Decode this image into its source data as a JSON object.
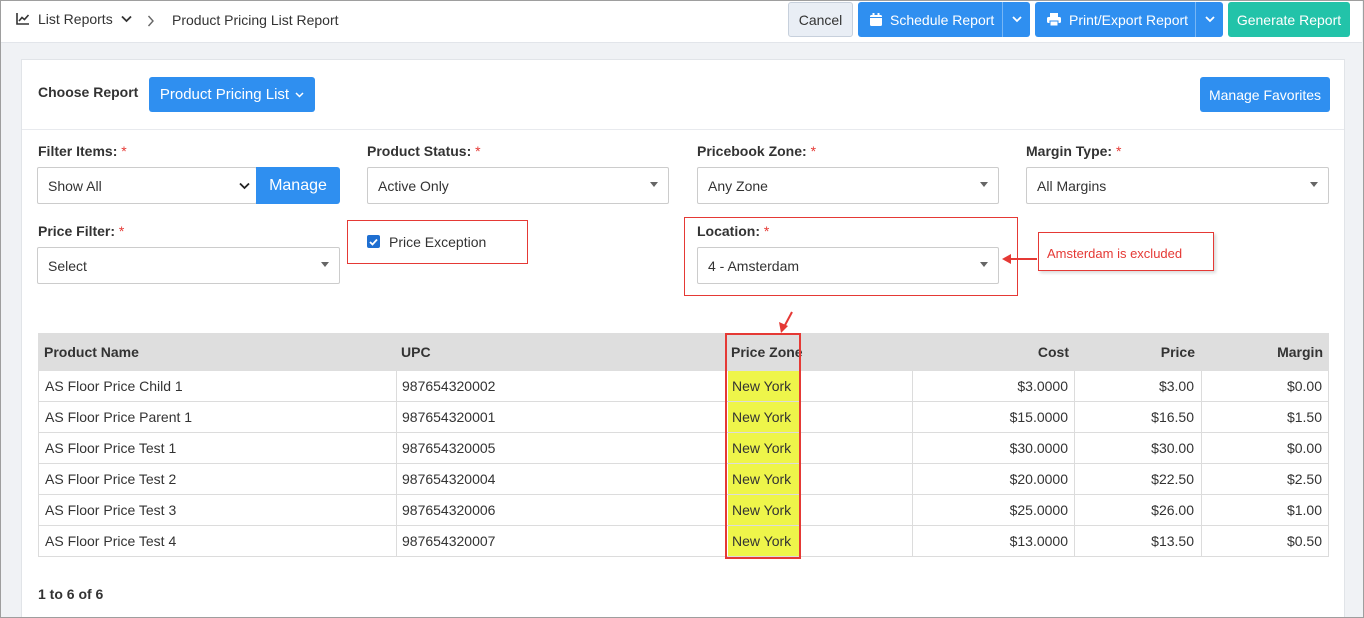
{
  "breadcrumb": {
    "root": "List Reports",
    "current": "Product Pricing List Report"
  },
  "toolbar": {
    "cancel": "Cancel",
    "schedule": "Schedule Report",
    "print": "Print/Export Report",
    "generate": "Generate Report"
  },
  "report": {
    "choose_label": "Choose Report",
    "selected": "Product Pricing List",
    "favorites": "Manage Favorites"
  },
  "filters": {
    "filter_items": {
      "label": "Filter Items:",
      "value": "Show All",
      "manage": "Manage"
    },
    "product_status": {
      "label": "Product Status:",
      "value": "Active Only"
    },
    "pricebook_zone": {
      "label": "Pricebook Zone:",
      "value": "Any Zone"
    },
    "margin_type": {
      "label": "Margin Type:",
      "value": "All Margins"
    },
    "price_filter": {
      "label": "Price Filter:",
      "value": "Select"
    },
    "price_exception": {
      "label": "Price Exception",
      "checked": true
    },
    "location": {
      "label": "Location:",
      "value": "4 - Amsterdam"
    },
    "required_mark": "*"
  },
  "annotation": {
    "callout": "Amsterdam is excluded",
    "color": "#e53935"
  },
  "table": {
    "columns": [
      "Product Name",
      "UPC",
      "Price Zone",
      "Cost",
      "Price",
      "Margin"
    ],
    "rows": [
      {
        "name": "AS Floor Price Child 1",
        "upc": "987654320002",
        "zone": "New York",
        "cost": "$3.0000",
        "price": "$3.00",
        "margin": "$0.00"
      },
      {
        "name": "AS Floor Price Parent 1",
        "upc": "987654320001",
        "zone": "New York",
        "cost": "$15.0000",
        "price": "$16.50",
        "margin": "$1.50"
      },
      {
        "name": "AS Floor Price Test 1",
        "upc": "987654320005",
        "zone": "New York",
        "cost": "$30.0000",
        "price": "$30.00",
        "margin": "$0.00"
      },
      {
        "name": "AS Floor Price Test 2",
        "upc": "987654320004",
        "zone": "New York",
        "cost": "$20.0000",
        "price": "$22.50",
        "margin": "$2.50"
      },
      {
        "name": "AS Floor Price Test 3",
        "upc": "987654320006",
        "zone": "New York",
        "cost": "$25.0000",
        "price": "$26.00",
        "margin": "$1.00"
      },
      {
        "name": "AS Floor Price Test 4",
        "upc": "987654320007",
        "zone": "New York",
        "cost": "$13.0000",
        "price": "$13.50",
        "margin": "$0.50"
      }
    ]
  },
  "pager": "1 to 6 of 6",
  "colors": {
    "primary": "#2f8ff0",
    "success": "#22c3a9",
    "highlight": "#eef54a"
  }
}
